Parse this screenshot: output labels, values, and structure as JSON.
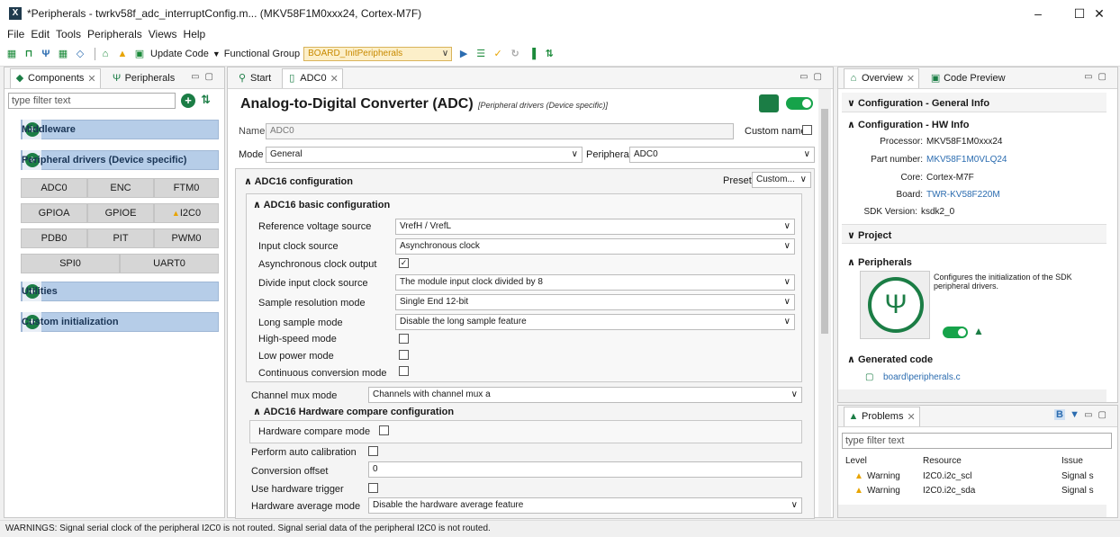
{
  "window": {
    "title": "*Peripherals - twrkv58f_adc_interruptConfig.m... (MKV58F1M0xxx24, Cortex-M7F)",
    "minimize": "–",
    "maximize": "☐",
    "close": "✕"
  },
  "menu": [
    "File",
    "Edit",
    "Tools",
    "Peripherals",
    "Views",
    "Help"
  ],
  "toolbar": {
    "update_code": "Update Code",
    "functional_group_label": "Functional Group",
    "functional_group_value": "BOARD_InitPeripherals"
  },
  "components_panel": {
    "tabs": [
      "Components",
      "Peripherals"
    ],
    "filter_placeholder": "type filter text",
    "middleware": "Middleware",
    "peripheral_drivers": "Peripheral drivers (Device specific)",
    "peripherals": [
      "ADC0",
      "ENC",
      "FTM0",
      "GPIOA",
      "GPIOE",
      "I2C0",
      "PDB0",
      "PIT",
      "PWM0",
      "SPI0",
      "UART0"
    ],
    "utilities": "Utilities",
    "custom_init": "Custom initialization"
  },
  "editor": {
    "tabs": [
      "Start",
      "ADC0"
    ],
    "heading": "Analog-to-Digital Converter (ADC)",
    "heading_sub": "[Peripheral drivers (Device specific)]",
    "name_label": "Name",
    "name_value": "ADC0",
    "custom_name_label": "Custom name",
    "mode_label": "Mode",
    "mode_value": "General",
    "peripheral_label": "Peripheral",
    "peripheral_value": "ADC0",
    "adc16_config": "ADC16 configuration",
    "preset_label": "Preset",
    "preset_value": "Custom...",
    "basic_config": "ADC16 basic configuration",
    "basic_rows": [
      {
        "label": "Reference voltage source",
        "value": "VrefH / VrefL"
      },
      {
        "label": "Input clock source",
        "value": "Asynchronous clock"
      },
      {
        "label": "Asynchronous clock output",
        "value": ""
      },
      {
        "label": "Divide input clock source",
        "value": "The module input clock divided by 8"
      },
      {
        "label": "Sample resolution mode",
        "value": "Single End 12-bit"
      },
      {
        "label": "Long sample mode",
        "value": "Disable the long sample feature"
      },
      {
        "label": "High-speed mode",
        "value": ""
      },
      {
        "label": "Low power mode",
        "value": ""
      },
      {
        "label": "Continuous conversion mode",
        "value": ""
      }
    ],
    "channel_mux_label": "Channel mux mode",
    "channel_mux_value": "Channels with channel mux a",
    "hw_compare_section": "ADC16 Hardware compare configuration",
    "hw_compare_mode": "Hardware compare mode",
    "auto_cal": "Perform auto calibration",
    "conv_offset_label": "Conversion offset",
    "conv_offset_value": "0",
    "hw_trigger": "Use hardware trigger",
    "hw_avg_label": "Hardware average mode",
    "hw_avg_value": "Disable the hardware average feature"
  },
  "overview": {
    "tabs": [
      "Overview",
      "Code Preview"
    ],
    "general_info": "Configuration - General Info",
    "hw_info": "Configuration - HW Info",
    "processor_label": "Processor:",
    "processor_value": "MKV58F1M0xxx24",
    "part_label": "Part number:",
    "part_value": "MKV58F1M0VLQ24",
    "core_label": "Core:",
    "core_value": "Cortex-M7F",
    "board_label": "Board:",
    "board_value": "TWR-KV58F220M",
    "sdk_label": "SDK Version:",
    "sdk_value": "ksdk2_0",
    "project": "Project",
    "peripherals": "Peripherals",
    "peripherals_desc": "Configures the initialization of the SDK peripheral drivers.",
    "generated_code": "Generated code",
    "generated_file": "board\\peripherals.c"
  },
  "problems": {
    "tab": "Problems",
    "filter_placeholder": "type filter text",
    "columns": [
      "Level",
      "Resource",
      "Issue"
    ],
    "rows": [
      {
        "level": "Warning",
        "resource": "I2C0.i2c_scl",
        "issue": "Signal s"
      },
      {
        "level": "Warning",
        "resource": "I2C0.i2c_sda",
        "issue": "Signal s"
      }
    ]
  },
  "status": "WARNINGS: Signal serial clock of the peripheral I2C0 is not routed. Signal serial data of the peripheral I2C0 is not routed.",
  "colors": {
    "accent_blue": "#b6cde8",
    "green": "#1b7d45",
    "warning": "#e8a400",
    "link": "#2b6cb0"
  }
}
